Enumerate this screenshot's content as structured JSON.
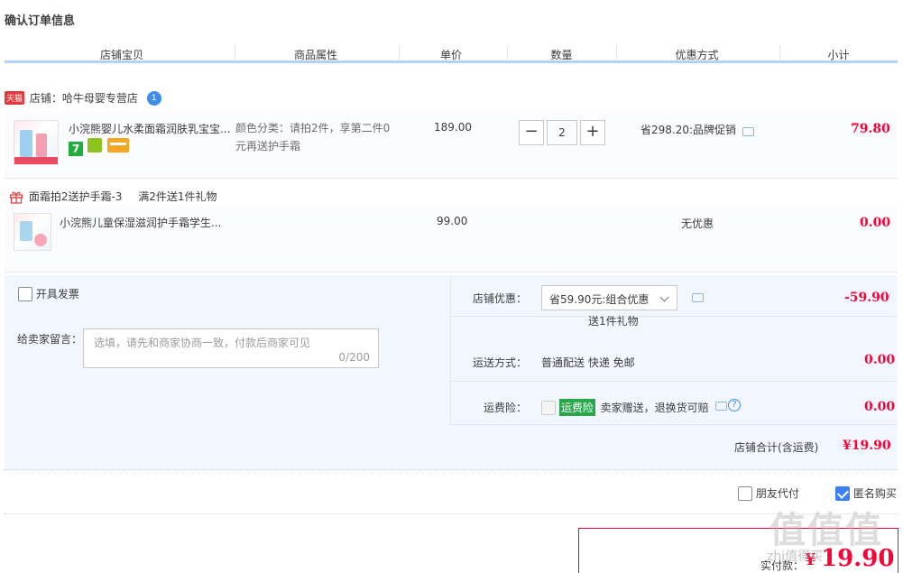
{
  "title": "确认订单信息",
  "columns": [
    "店铺宝贝",
    "商品属性",
    "单价",
    "数量",
    "优惠方式",
    "小计"
  ],
  "shop": {
    "badge": "天猫",
    "label": "店铺：哈牛母婴专营店",
    "chat_badge": "1"
  },
  "item1": {
    "name": "小浣熊婴儿水柔面霜润肤乳宝宝...",
    "attr_line1": "颜色分类：请拍2件，享第二件0",
    "attr_line2": "元再送护手霜",
    "price": "189.00",
    "qty": "2",
    "minus": "−",
    "plus": "+",
    "promo": "省298.20:品牌促销",
    "subtotal": "79.80",
    "badge_7": "7"
  },
  "gift": {
    "label": "面霜拍2送护手霜-3",
    "note": "满2件送1件礼物"
  },
  "item2": {
    "name": "小浣熊儿童保湿滋润护手霜学生...",
    "price": "99.00",
    "promo": "无优惠",
    "subtotal": "0.00"
  },
  "invoice": {
    "label": "开具发票"
  },
  "message": {
    "label": "给卖家留言：",
    "placeholder": "选填，请先和商家协商一致，付款后商家可见",
    "count": "0/200"
  },
  "shop_discount": {
    "label": "店铺优惠：",
    "selected": "省59.90元:组合优惠",
    "gift_note": "送1件礼物",
    "amount": "-59.90"
  },
  "shipping": {
    "label": "运送方式：",
    "value": "普通配送 快递 免邮",
    "amount": "0.00"
  },
  "insurance": {
    "label": "运费险：",
    "badge": "运费险",
    "value": "卖家赠送，退换货可赔",
    "amount": "0.00"
  },
  "shop_total": {
    "label": "店铺合计(含运费)",
    "value": "¥19.90"
  },
  "friend_pay": {
    "label": "朋友代付"
  },
  "anonymous": {
    "label": "匿名购买"
  },
  "actual_pay": {
    "label": "实付款：",
    "currency": "¥",
    "value": "19.90"
  },
  "watermark": {
    "text": "值值值",
    "sub": "zhi值得买"
  },
  "colors": {
    "accent_red": "#ff0036",
    "header_line": "#b2d1ff",
    "panel_bg": "#f2f7ff",
    "checkbox_blue": "#3d7ff5"
  }
}
